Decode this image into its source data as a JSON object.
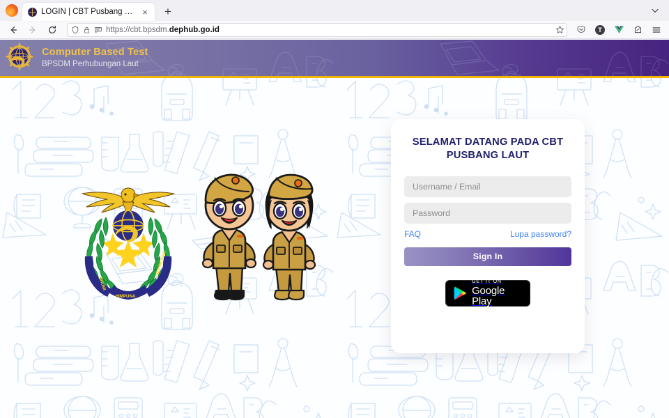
{
  "browser": {
    "tab": {
      "title": "LOGIN | CBT Pusbang Laut",
      "favicon_name": "globe-favicon",
      "close_label": "×"
    },
    "new_tab_label": "+",
    "tab_list_chevron": "⌄",
    "nav": {
      "back_label": "←",
      "forward_label": "→",
      "reload_label": "⟳"
    },
    "url": {
      "scheme_and_sub": "https://cbt.bpsdm.",
      "domain": "dephub.go.id",
      "shield_icon": "shield-icon",
      "lock_icon": "lock-icon",
      "reader_icon": "reader-mode-icon",
      "bookmark_icon": "star-icon"
    },
    "toolbar_icons": [
      {
        "name": "pocket-icon",
        "glyph": "❤"
      },
      {
        "name": "extension-badge-icon",
        "glyph": "T"
      },
      {
        "name": "vue-devtools-icon",
        "glyph": "V"
      },
      {
        "name": "save-to-pocket-icon",
        "glyph": "↱"
      },
      {
        "name": "app-menu-icon",
        "glyph": "☰"
      }
    ],
    "accent_colors": {
      "tabstrip_bg": "#f0f0f4",
      "navbar_bg": "#f9f9fb",
      "url_text": "#6b6b75"
    }
  },
  "site": {
    "header": {
      "title": "Computer Based Test",
      "subtitle": "BPSDM Perhubungan Laut",
      "logo_name": "bpsdm-globe-crest-logo",
      "title_color": "#f0c24a",
      "band_gradient_from": "#8480ab",
      "band_gradient_to": "#46237f",
      "band_border_color": "#f2b705"
    },
    "hero": {
      "emblem_name": "bpsdm-perhubungan-laut-emblem",
      "emblem_motto": "BHUMI MAHESTA HIMPUNA UDAYACANA",
      "mascots_name": "cbt-cadet-mascots",
      "mascot_left": "male-cadet-mascot",
      "mascot_right": "female-cadet-mascot"
    },
    "background": {
      "pattern_name": "education-doodle-pattern",
      "line_color": "#cfe0f5",
      "base_color": "#fdfeff"
    },
    "login": {
      "title": "SELAMAT DATANG PADA CBT PUSBANG LAUT",
      "title_color": "#22216b",
      "username_placeholder": "Username / Email",
      "username_value": "",
      "password_placeholder": "Password",
      "password_value": "",
      "faq_label": "FAQ",
      "forgot_label": "Lupa password?",
      "link_color": "#4285f4",
      "signin_label": "Sign In",
      "signin_gradient_from": "#9a92c4",
      "signin_gradient_to": "#51369a",
      "google_play": {
        "small_text": "GET IT ON",
        "big_text": "Google Play",
        "badge_name": "google-play-badge"
      }
    }
  }
}
